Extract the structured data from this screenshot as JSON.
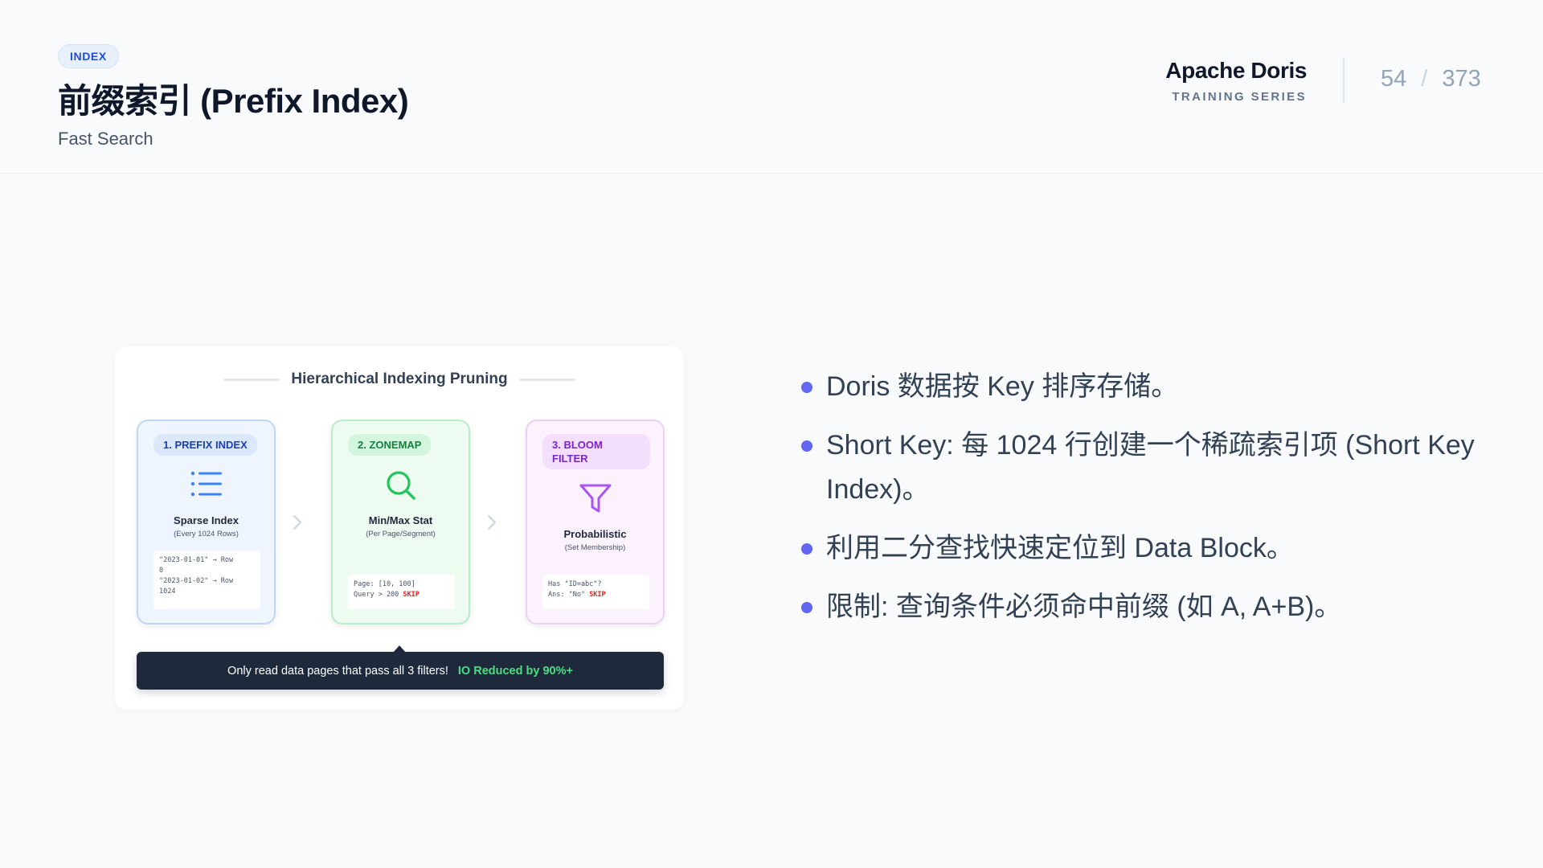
{
  "header": {
    "tag": "INDEX",
    "title": "前缀索引 (Prefix Index)",
    "subtitle": "Fast Search",
    "brand_name": "Apache Doris",
    "brand_sub": "TRAINING SERIES",
    "page_current": "54",
    "page_separator": "/",
    "page_total": "373"
  },
  "diagram": {
    "title": "Hierarchical Indexing Pruning",
    "stages": [
      {
        "label": "1. PREFIX INDEX",
        "icon": "list-icon",
        "name": "Sparse Index",
        "note": "(Every 1024 Rows)",
        "code": [
          "\"2023-01-01\" → Row",
          "0",
          "\"2023-01-02\" → Row",
          "1024"
        ]
      },
      {
        "label": "2. ZONEMAP",
        "icon": "search-icon",
        "name": "Min/Max Stat",
        "note": "(Per Page/Segment)",
        "code": [
          "Page: [10, 100]",
          "Query > 200"
        ],
        "skip": "SKIP"
      },
      {
        "label": "3. BLOOM FILTER",
        "icon": "funnel-icon",
        "name": "Probabilistic",
        "note": "(Set Membership)",
        "code": [
          "Has \"ID=abc\"?",
          "Ans: \"No\""
        ],
        "skip": "SKIP"
      }
    ],
    "summary_text": "Only read data pages that pass all 3 filters!",
    "summary_highlight": "IO Reduced by 90%+"
  },
  "bullets": [
    "Doris 数据按 Key 排序存储。",
    "Short Key: 每 1024 行创建一个稀疏索引项 (Short Key Index)。",
    "利用二分查找快速定位到 Data Block。",
    "限制: 查询条件必须命中前缀 (如 A, A+B)。"
  ],
  "colors": {
    "accent": "#6366f1",
    "stage1": "#3b82f6",
    "stage2": "#22c55e",
    "stage3": "#a855f7",
    "highlight": "#4ade80",
    "skip": "#dc2626"
  }
}
